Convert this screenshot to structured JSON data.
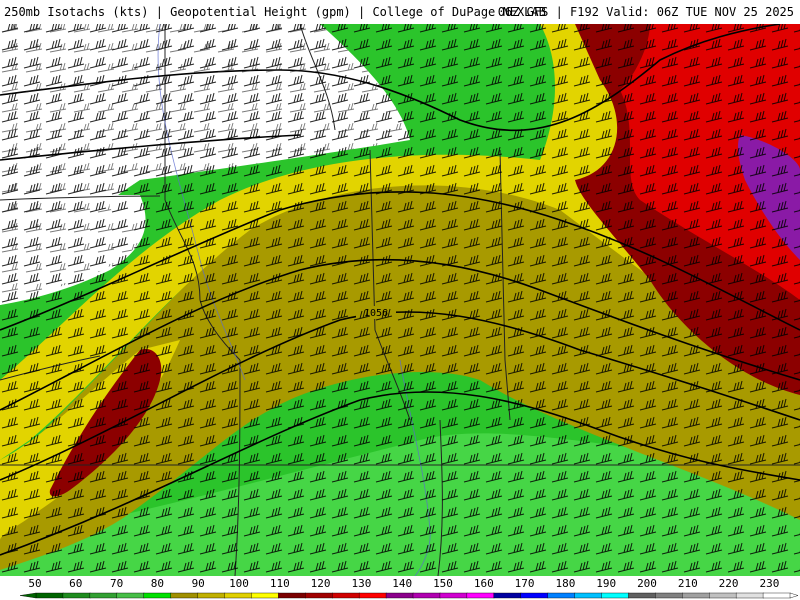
{
  "header": {
    "title_left": "250mb Isotachs (kts) | Geopotential Height (gpm) | College of DuPage NEXLAB",
    "title_right": "06Z GFS | F192 Valid: 06Z TUE NOV 25 2025"
  },
  "map": {
    "contour_label": "1056"
  },
  "legend": {
    "ticks": [
      "50",
      "60",
      "70",
      "80",
      "90",
      "100",
      "110",
      "120",
      "130",
      "140",
      "150",
      "160",
      "170",
      "180",
      "190",
      "200",
      "210",
      "220",
      "230"
    ],
    "colors": [
      "#006400",
      "#1e8c1e",
      "#32a032",
      "#46be46",
      "#00e000",
      "#a09000",
      "#c0b000",
      "#e0d000",
      "#ffff00",
      "#7a0000",
      "#a00000",
      "#d00000",
      "#ff0000",
      "#8b008b",
      "#b000b0",
      "#d000d0",
      "#ff00ff",
      "#0000a0",
      "#0000ff",
      "#0080ff",
      "#00c0ff",
      "#00ffff",
      "#606060",
      "#808080",
      "#a0a0a0",
      "#c0c0c0",
      "#e0e0e0",
      "#ffffff"
    ]
  }
}
